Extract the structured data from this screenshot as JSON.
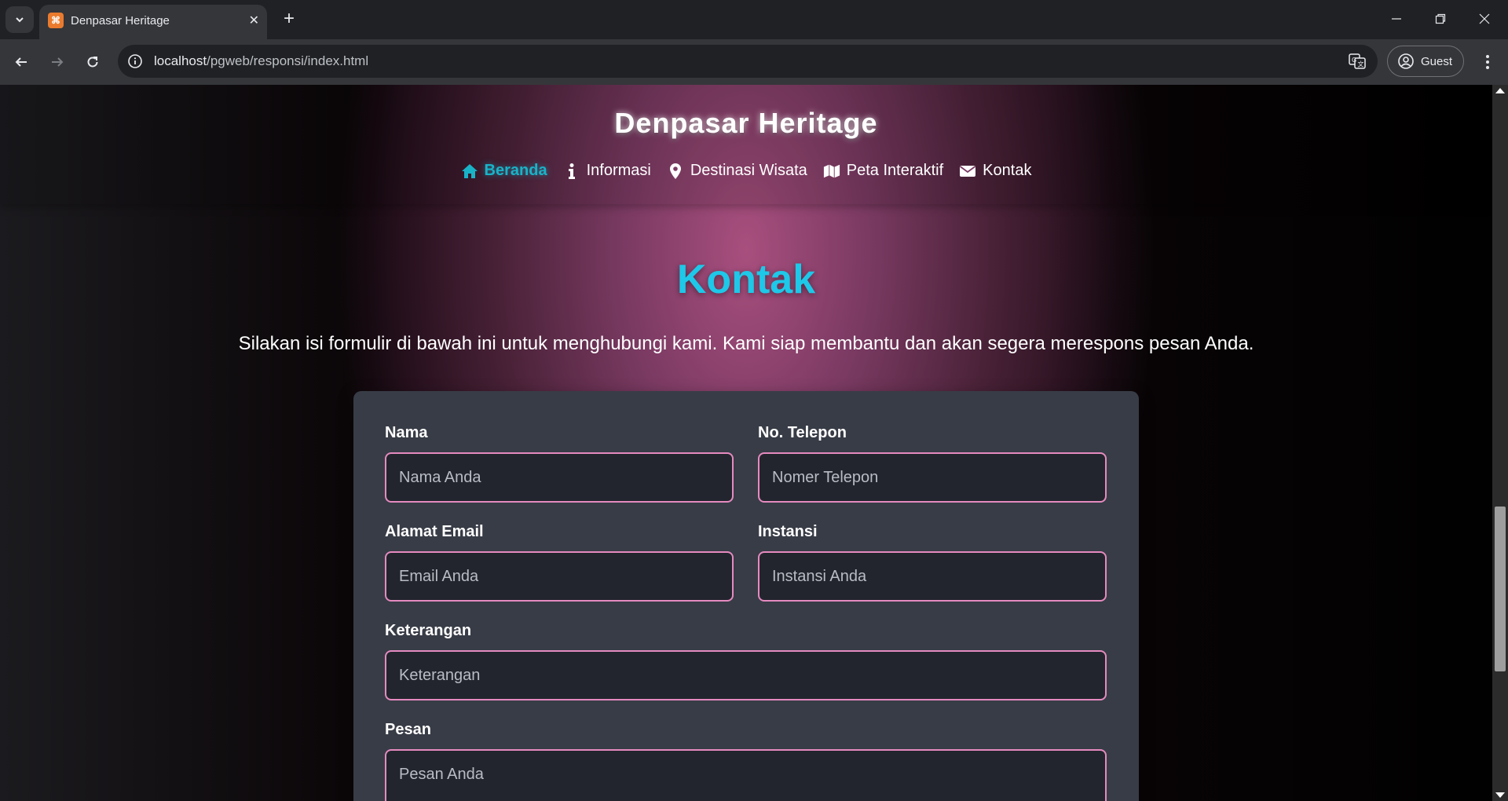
{
  "browser": {
    "tab_title": "Denpasar Heritage",
    "favicon": "xampp-icon",
    "url_host": "localhost",
    "url_path": "/pgweb/responsi/index.html",
    "profile_label": "Guest"
  },
  "site": {
    "title": "Denpasar Heritage",
    "nav": [
      {
        "label": "Beranda",
        "icon": "home-icon",
        "active": true
      },
      {
        "label": "Informasi",
        "icon": "info-icon",
        "active": false
      },
      {
        "label": "Destinasi Wisata",
        "icon": "map-marker-icon",
        "active": false
      },
      {
        "label": "Peta Interaktif",
        "icon": "map-icon",
        "active": false
      },
      {
        "label": "Kontak",
        "icon": "envelope-icon",
        "active": false
      }
    ]
  },
  "contact": {
    "title": "Kontak",
    "description": "Silakan isi formulir di bawah ini untuk menghubungi kami. Kami siap membantu dan akan segera merespons pesan Anda.",
    "fields": {
      "nama": {
        "label": "Nama",
        "placeholder": "Nama Anda"
      },
      "telepon": {
        "label": "No. Telepon",
        "placeholder": "Nomer Telepon"
      },
      "email": {
        "label": "Alamat Email",
        "placeholder": "Email Anda"
      },
      "instansi": {
        "label": "Instansi",
        "placeholder": "Instansi Anda"
      },
      "keterangan": {
        "label": "Keterangan",
        "placeholder": "Keterangan"
      },
      "pesan": {
        "label": "Pesan",
        "placeholder": "Pesan Anda"
      }
    }
  },
  "colors": {
    "accent_title": "#1ec8e8",
    "active_nav": "#19b3c8",
    "input_border": "#e58ac0",
    "card_bg": "#383c46"
  }
}
